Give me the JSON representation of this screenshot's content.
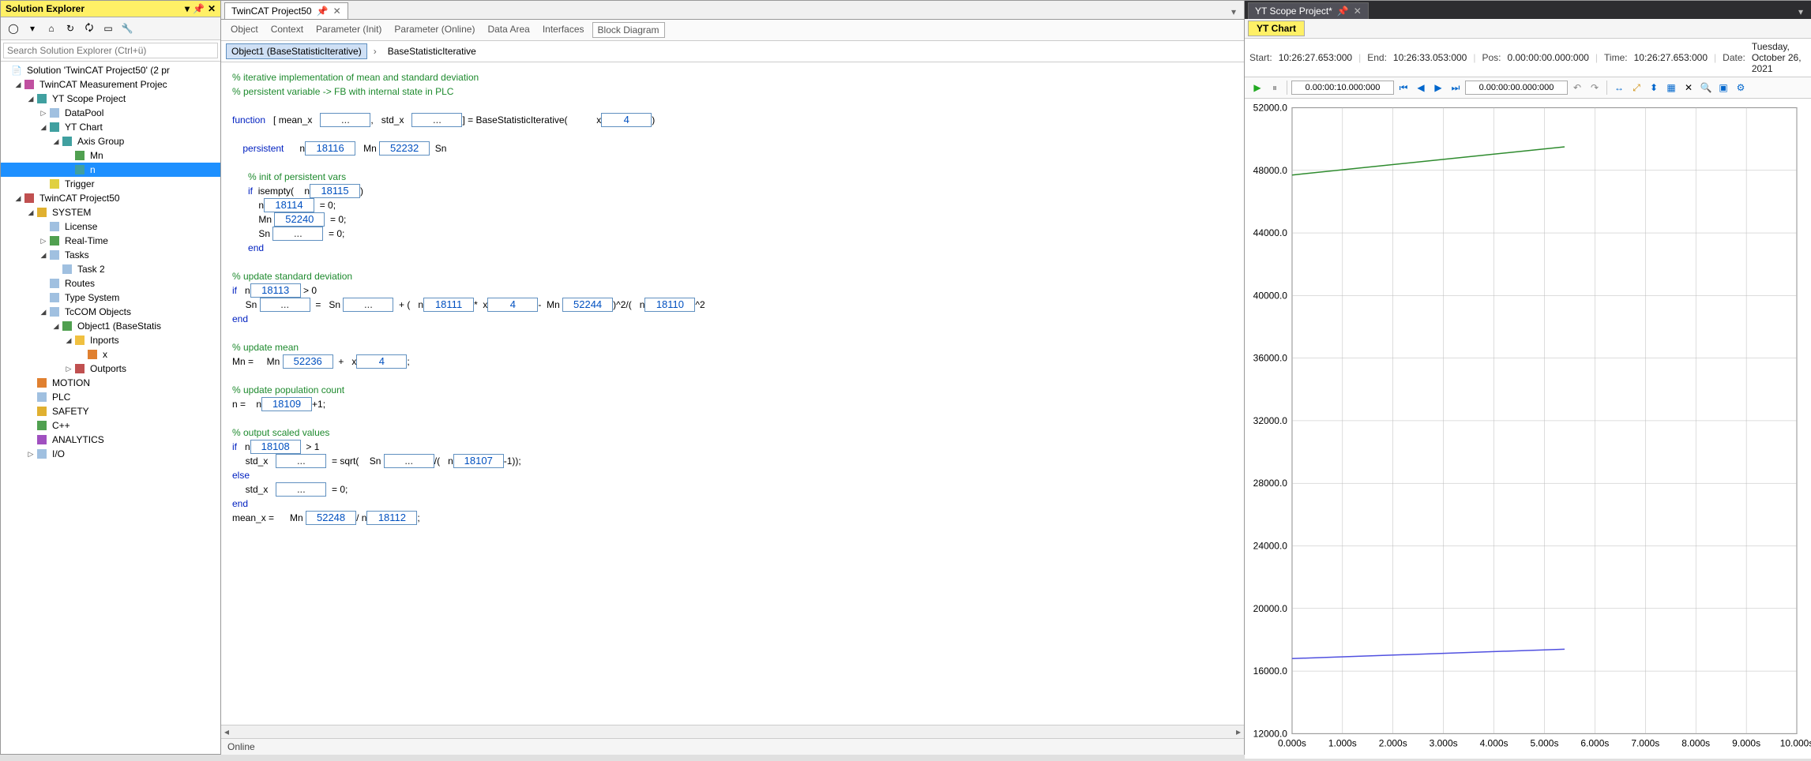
{
  "solution": {
    "title": "Solution Explorer",
    "search_placeholder": "Search Solution Explorer (Ctrl+ü)",
    "tree": {
      "root": "Solution 'TwinCAT Project50' (2 pr",
      "meas_proj": "TwinCAT Measurement Projec",
      "scope_proj": "YT Scope Project",
      "datapool": "DataPool",
      "ytchart": "YT Chart",
      "axisgroup": "Axis Group",
      "mn": "Mn",
      "n": "n",
      "trigger": "Trigger",
      "tc_proj": "TwinCAT Project50",
      "system": "SYSTEM",
      "license": "License",
      "realtime": "Real-Time",
      "tasks": "Tasks",
      "task2": "Task 2",
      "routes": "Routes",
      "typesystem": "Type System",
      "tccom": "TcCOM Objects",
      "obj1": "Object1 (BaseStatis",
      "inports": "Inports",
      "x": "x",
      "outports": "Outports",
      "motion": "MOTION",
      "plc": "PLC",
      "safety": "SAFETY",
      "cpp": "C++",
      "analytics": "ANALYTICS",
      "io": "I/O"
    }
  },
  "editor": {
    "tab_title": "TwinCAT Project50",
    "sub_tabs": [
      "Object",
      "Context",
      "Parameter (Init)",
      "Parameter (Online)",
      "Data Area",
      "Interfaces",
      "Block Diagram"
    ],
    "active_sub_tab": "Block Diagram",
    "breadcrumb": {
      "item1": "Object1 (BaseStatisticIterative)",
      "item2": "BaseStatisticIterative"
    },
    "code": {
      "c1": "% iterative implementation of mean and standard deviation",
      "c2": "% persistent variable -> FB with internal state in PLC",
      "func": "function",
      "meanx": "mean_x",
      "stdx": "std_x",
      "basefn": "= BaseStatisticIterative(",
      "x": "x",
      "x_val": "4",
      "persistent": "persistent",
      "n": "n",
      "n_val": "18116",
      "Mn": "Mn",
      "Mn_val": "52232",
      "Sn": "Sn",
      "c_init": "% init of persistent vars",
      "if": "if",
      "isempty": "isempty(",
      "n_ie": "18115",
      "n_init": "18114",
      "eq0": "= 0;",
      "Mn_init": "52240",
      "end": "end",
      "c_std": "% update standard deviation",
      "n_std": "18113",
      "gt0": "> 0",
      "n_sd2": "18111",
      "x_sd": "4",
      "Mn_sd": "52244",
      "n_sd3": "18110",
      "c_mean": "% update mean",
      "Mn_eq": "Mn =",
      "Mn_upd": "52236",
      "x_upd": "4",
      "c_pop": "% update population count",
      "n_eq": "n =",
      "n_pop": "18109",
      "plus1": "+1;",
      "c_out": "% output scaled values",
      "n_out": "18108",
      "gt1": "> 1",
      "sqrt": "= sqrt(",
      "n_out2": "18107",
      "m1": "-1));",
      "else": "else",
      "meanx_eq": "mean_x =",
      "Mn_fin": "52248",
      "slash_n": "/ n",
      "n_fin": "18112",
      "dots": "..."
    },
    "status": "Online"
  },
  "scope": {
    "tab_title": "YT Scope Project*",
    "chart_tab": "YT Chart",
    "info": {
      "start_label": "Start:",
      "start": "10:26:27.653:000",
      "end_label": "End:",
      "end": "10:26:33.053:000",
      "pos_label": "Pos:",
      "pos": "0.00:00:00.000:000",
      "time_label": "Time:",
      "time": "10:26:27.653:000",
      "date_label": "Date:",
      "date": "Tuesday, October 26, 2021"
    },
    "toolbar": {
      "t1": "0.00:00:10.000:000",
      "t2": "0.00:00:00.000:000"
    }
  },
  "chart_data": {
    "type": "line",
    "xlabel": "",
    "ylabel": "",
    "x_ticks": [
      "0.000s",
      "1.000s",
      "2.000s",
      "3.000s",
      "4.000s",
      "5.000s",
      "6.000s",
      "7.000s",
      "8.000s",
      "9.000s",
      "10.000s"
    ],
    "y_ticks": [
      12000.0,
      16000.0,
      20000.0,
      24000.0,
      28000.0,
      32000.0,
      36000.0,
      40000.0,
      44000.0,
      48000.0,
      52000.0
    ],
    "ylim": [
      12000,
      52000
    ],
    "xlim": [
      0,
      10
    ],
    "series": [
      {
        "name": "Mn",
        "color": "#2e8b2e",
        "x": [
          0.0,
          5.4
        ],
        "values": [
          47700,
          49500
        ]
      },
      {
        "name": "n",
        "color": "#5050e0",
        "x": [
          0.0,
          5.4
        ],
        "values": [
          16800,
          17400
        ]
      }
    ]
  }
}
